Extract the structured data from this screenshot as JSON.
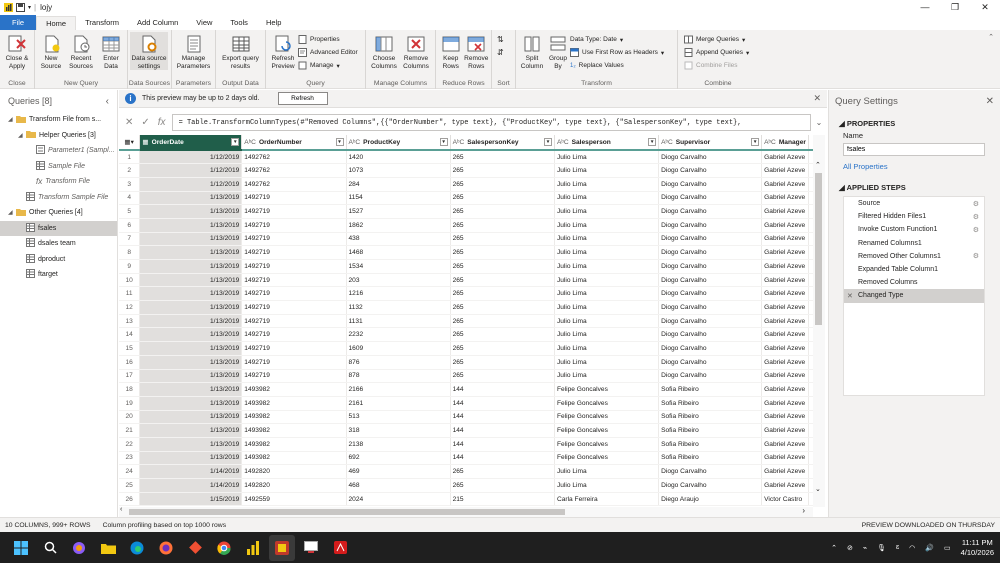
{
  "title_bar": {
    "title": "lojy"
  },
  "tabs": [
    "File",
    "Home",
    "Transform",
    "Add Column",
    "View",
    "Tools",
    "Help"
  ],
  "ribbon": {
    "close": {
      "close_apply": "Close & Apply",
      "group": "Close"
    },
    "new_query": {
      "new_source": "New Source",
      "recent_sources": "Recent Sources",
      "enter_data": "Enter Data",
      "group": "New Query"
    },
    "data_sources": {
      "settings": "Data source settings",
      "group": "Data Sources"
    },
    "parameters": {
      "manage": "Manage Parameters",
      "group": "Parameters"
    },
    "output": {
      "export": "Export query results",
      "group": "Output Data"
    },
    "query": {
      "refresh": "Refresh Preview",
      "properties": "Properties",
      "advanced": "Advanced Editor",
      "manage": "Manage",
      "group": "Query"
    },
    "manage_columns": {
      "choose": "Choose Columns",
      "remove": "Remove Columns",
      "group": "Manage Columns"
    },
    "reduce_rows": {
      "keep": "Keep Rows",
      "remove": "Remove Rows",
      "group": "Reduce Rows"
    },
    "sort": {
      "group": "Sort"
    },
    "transform": {
      "split": "Split Column",
      "group_by": "Group By",
      "data_type": "Data Type: Date",
      "first_row": "Use First Row as Headers",
      "replace": "Replace Values",
      "group": "Transform"
    },
    "combine": {
      "merge": "Merge Queries",
      "append": "Append Queries",
      "combine_files": "Combine Files",
      "group": "Combine"
    }
  },
  "queries_pane": {
    "header": "Queries [8]",
    "items": [
      {
        "label": "Transform File from s...",
        "level": 0,
        "kind": "folder",
        "open": true
      },
      {
        "label": "Helper Queries [3]",
        "level": 1,
        "kind": "folder",
        "open": true
      },
      {
        "label": "Parameter1 (Sampl...",
        "level": 2,
        "kind": "param"
      },
      {
        "label": "Sample File",
        "level": 2,
        "kind": "table"
      },
      {
        "label": "Transform File",
        "level": 2,
        "kind": "fx"
      },
      {
        "label": "Transform Sample File",
        "level": 1,
        "kind": "table"
      },
      {
        "label": "Other Queries [4]",
        "level": 0,
        "kind": "folder",
        "open": true
      },
      {
        "label": "fsales",
        "level": 1,
        "kind": "table",
        "selected": true
      },
      {
        "label": "dsales team",
        "level": 1,
        "kind": "table"
      },
      {
        "label": "dproduct",
        "level": 1,
        "kind": "table"
      },
      {
        "label": "ftarget",
        "level": 1,
        "kind": "table"
      }
    ]
  },
  "banner": {
    "text": "This preview may be up to 2 days old.",
    "button": "Refresh"
  },
  "formula": {
    "text": "= Table.TransformColumnTypes(#\"Removed Columns\",{{\"OrderNumber\", type text}, {\"ProductKey\", type text}, {\"SalespersonKey\", type text},"
  },
  "grid": {
    "columns": [
      {
        "name": "OrderDate",
        "type": "date",
        "selected": true
      },
      {
        "name": "OrderNumber",
        "type": "ABC"
      },
      {
        "name": "ProductKey",
        "type": "ABC"
      },
      {
        "name": "SalespersonKey",
        "type": "ABC"
      },
      {
        "name": "Salesperson",
        "type": "ABC"
      },
      {
        "name": "Supervisor",
        "type": "ABC"
      },
      {
        "name": "Manager",
        "type": "ABC"
      }
    ],
    "rows": [
      [
        "1/12/2019",
        "1492762",
        "1420",
        "265",
        "Julio Lima",
        "Diogo Carvalho",
        "Gabriel Azeve"
      ],
      [
        "1/12/2019",
        "1492762",
        "1073",
        "265",
        "Julio Lima",
        "Diogo Carvalho",
        "Gabriel Azeve"
      ],
      [
        "1/12/2019",
        "1492762",
        "284",
        "265",
        "Julio Lima",
        "Diogo Carvalho",
        "Gabriel Azeve"
      ],
      [
        "1/13/2019",
        "1492719",
        "1154",
        "265",
        "Julio Lima",
        "Diogo Carvalho",
        "Gabriel Azeve"
      ],
      [
        "1/13/2019",
        "1492719",
        "1527",
        "265",
        "Julio Lima",
        "Diogo Carvalho",
        "Gabriel Azeve"
      ],
      [
        "1/13/2019",
        "1492719",
        "1862",
        "265",
        "Julio Lima",
        "Diogo Carvalho",
        "Gabriel Azeve"
      ],
      [
        "1/13/2019",
        "1492719",
        "438",
        "265",
        "Julio Lima",
        "Diogo Carvalho",
        "Gabriel Azeve"
      ],
      [
        "1/13/2019",
        "1492719",
        "1468",
        "265",
        "Julio Lima",
        "Diogo Carvalho",
        "Gabriel Azeve"
      ],
      [
        "1/13/2019",
        "1492719",
        "1534",
        "265",
        "Julio Lima",
        "Diogo Carvalho",
        "Gabriel Azeve"
      ],
      [
        "1/13/2019",
        "1492719",
        "203",
        "265",
        "Julio Lima",
        "Diogo Carvalho",
        "Gabriel Azeve"
      ],
      [
        "1/13/2019",
        "1492719",
        "1216",
        "265",
        "Julio Lima",
        "Diogo Carvalho",
        "Gabriel Azeve"
      ],
      [
        "1/13/2019",
        "1492719",
        "1132",
        "265",
        "Julio Lima",
        "Diogo Carvalho",
        "Gabriel Azeve"
      ],
      [
        "1/13/2019",
        "1492719",
        "1131",
        "265",
        "Julio Lima",
        "Diogo Carvalho",
        "Gabriel Azeve"
      ],
      [
        "1/13/2019",
        "1492719",
        "2232",
        "265",
        "Julio Lima",
        "Diogo Carvalho",
        "Gabriel Azeve"
      ],
      [
        "1/13/2019",
        "1492719",
        "1609",
        "265",
        "Julio Lima",
        "Diogo Carvalho",
        "Gabriel Azeve"
      ],
      [
        "1/13/2019",
        "1492719",
        "876",
        "265",
        "Julio Lima",
        "Diogo Carvalho",
        "Gabriel Azeve"
      ],
      [
        "1/13/2019",
        "1492719",
        "878",
        "265",
        "Julio Lima",
        "Diogo Carvalho",
        "Gabriel Azeve"
      ],
      [
        "1/13/2019",
        "1493982",
        "2166",
        "144",
        "Felipe Goncalves",
        "Sofia Ribeiro",
        "Gabriel Azeve"
      ],
      [
        "1/13/2019",
        "1493982",
        "2161",
        "144",
        "Felipe Goncalves",
        "Sofia Ribeiro",
        "Gabriel Azeve"
      ],
      [
        "1/13/2019",
        "1493982",
        "513",
        "144",
        "Felipe Goncalves",
        "Sofia Ribeiro",
        "Gabriel Azeve"
      ],
      [
        "1/13/2019",
        "1493982",
        "318",
        "144",
        "Felipe Goncalves",
        "Sofia Ribeiro",
        "Gabriel Azeve"
      ],
      [
        "1/13/2019",
        "1493982",
        "2138",
        "144",
        "Felipe Goncalves",
        "Sofia Ribeiro",
        "Gabriel Azeve"
      ],
      [
        "1/13/2019",
        "1493982",
        "692",
        "144",
        "Felipe Goncalves",
        "Sofia Ribeiro",
        "Gabriel Azeve"
      ],
      [
        "1/14/2019",
        "1492820",
        "469",
        "265",
        "Julio Lima",
        "Diogo Carvalho",
        "Gabriel Azeve"
      ],
      [
        "1/14/2019",
        "1492820",
        "468",
        "265",
        "Julio Lima",
        "Diogo Carvalho",
        "Gabriel Azeve"
      ],
      [
        "1/15/2019",
        "1492559",
        "2024",
        "215",
        "Carla Ferreira",
        "Diego Araujo",
        "Victor Castro"
      ]
    ]
  },
  "query_settings": {
    "title": "Query Settings",
    "properties": "PROPERTIES",
    "name_label": "Name",
    "name_value": "fsales",
    "all_properties": "All Properties",
    "applied_steps": "APPLIED STEPS",
    "steps": [
      {
        "label": "Source",
        "gear": true
      },
      {
        "label": "Filtered Hidden Files1",
        "gear": true
      },
      {
        "label": "Invoke Custom Function1",
        "gear": true
      },
      {
        "label": "Renamed Columns1",
        "gear": false
      },
      {
        "label": "Removed Other Columns1",
        "gear": true
      },
      {
        "label": "Expanded Table Column1",
        "gear": false
      },
      {
        "label": "Removed Columns",
        "gear": false
      },
      {
        "label": "Changed Type",
        "gear": false,
        "selected": true
      }
    ]
  },
  "status": {
    "left": "10 COLUMNS, 999+ ROWS",
    "middle": "Column profiling based on top 1000 rows",
    "right": "PREVIEW DOWNLOADED ON THURSDAY"
  },
  "taskbar": {
    "time": "11:11 PM",
    "date": "4/10/2026"
  },
  "colors": {
    "accent": "#2a73c8",
    "selected_header": "#205e4a",
    "header_line": "#5a9f95"
  }
}
